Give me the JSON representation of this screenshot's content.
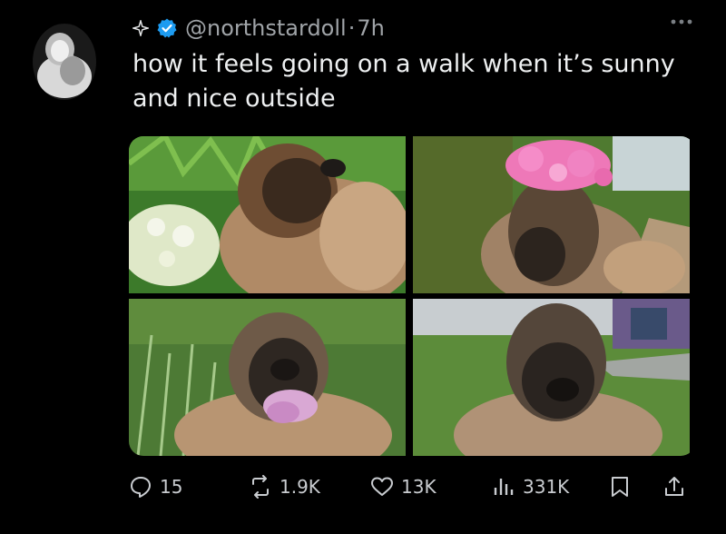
{
  "tweet": {
    "handle": "@northstardoll",
    "separator": "·",
    "time": "7h",
    "text": "how it feels going on a walk when it’s sunny and nice outside"
  },
  "icons": {
    "sparkle": "sparkle-icon",
    "verified": "verified-badge-icon",
    "more": "more-icon",
    "reply": "reply-icon",
    "retweet": "retweet-icon",
    "like": "heart-icon",
    "views": "views-chart-icon",
    "bookmark": "bookmark-icon",
    "share": "share-icon"
  },
  "colors": {
    "verified": "#1d9bf0",
    "background": "#000000",
    "text": "#e7e9ea",
    "muted": "#9aa0a6"
  },
  "actions": {
    "replies": "15",
    "retweets": "1.9K",
    "likes": "13K",
    "views": "331K"
  }
}
